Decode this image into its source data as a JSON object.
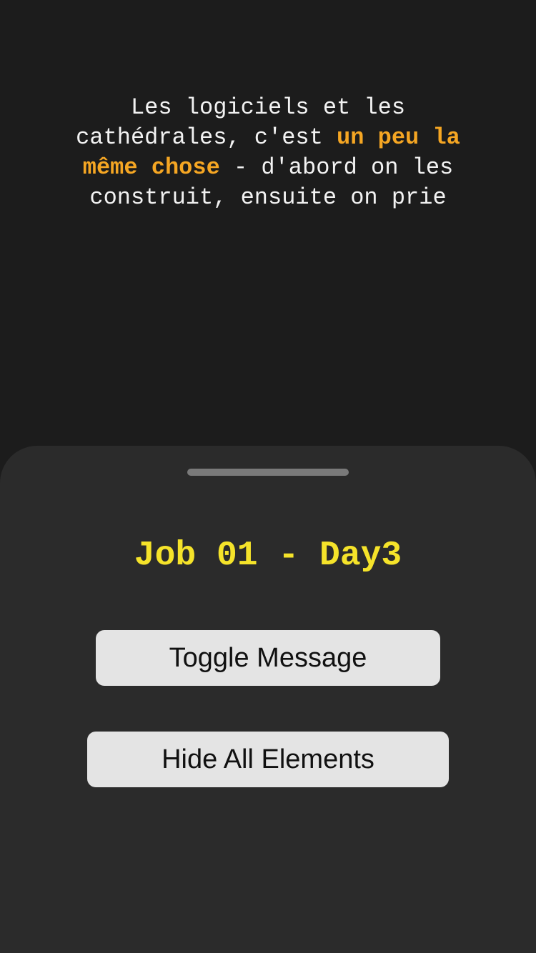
{
  "quote": {
    "before": "Les logiciels et les cathédrales, c'est ",
    "highlight": "un peu la même chose",
    "after": " - d'abord on les construit, ensuite on prie"
  },
  "sheet": {
    "title": "Job 01 - Day3",
    "toggle_label": "Toggle Message",
    "hide_label": "Hide All Elements"
  },
  "colors": {
    "background": "#1c1c1c",
    "sheet": "#2b2b2b",
    "highlight": "#f5a623",
    "title": "#f5e32a",
    "button": "#e4e4e4"
  }
}
